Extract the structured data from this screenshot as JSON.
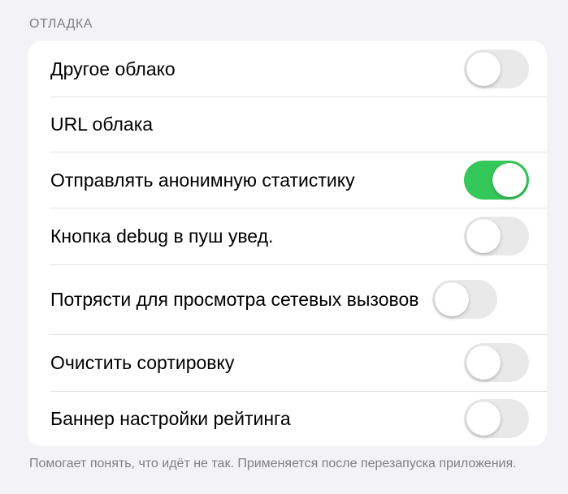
{
  "section": {
    "header": "ОТЛАДКА"
  },
  "rows": [
    {
      "label": "Другое облако",
      "toggle": false
    },
    {
      "label": "URL облака"
    },
    {
      "label": "Отправлять анонимную статистику",
      "toggle": true
    },
    {
      "label": "Кнопка debug в пуш увед.",
      "toggle": false
    },
    {
      "label": "Потрясти для просмотра сетевых вызовов",
      "toggle": false
    },
    {
      "label": "Очистить сортировку",
      "toggle": false
    },
    {
      "label": "Баннер настройки рейтинга",
      "toggle": false
    }
  ],
  "footer": "Помогает понять, что идёт не так. Применяется после перезапуска приложения.",
  "colors": {
    "toggle_on": "#34c759",
    "toggle_off": "#e9e9ea",
    "background": "#f2f2f7"
  }
}
